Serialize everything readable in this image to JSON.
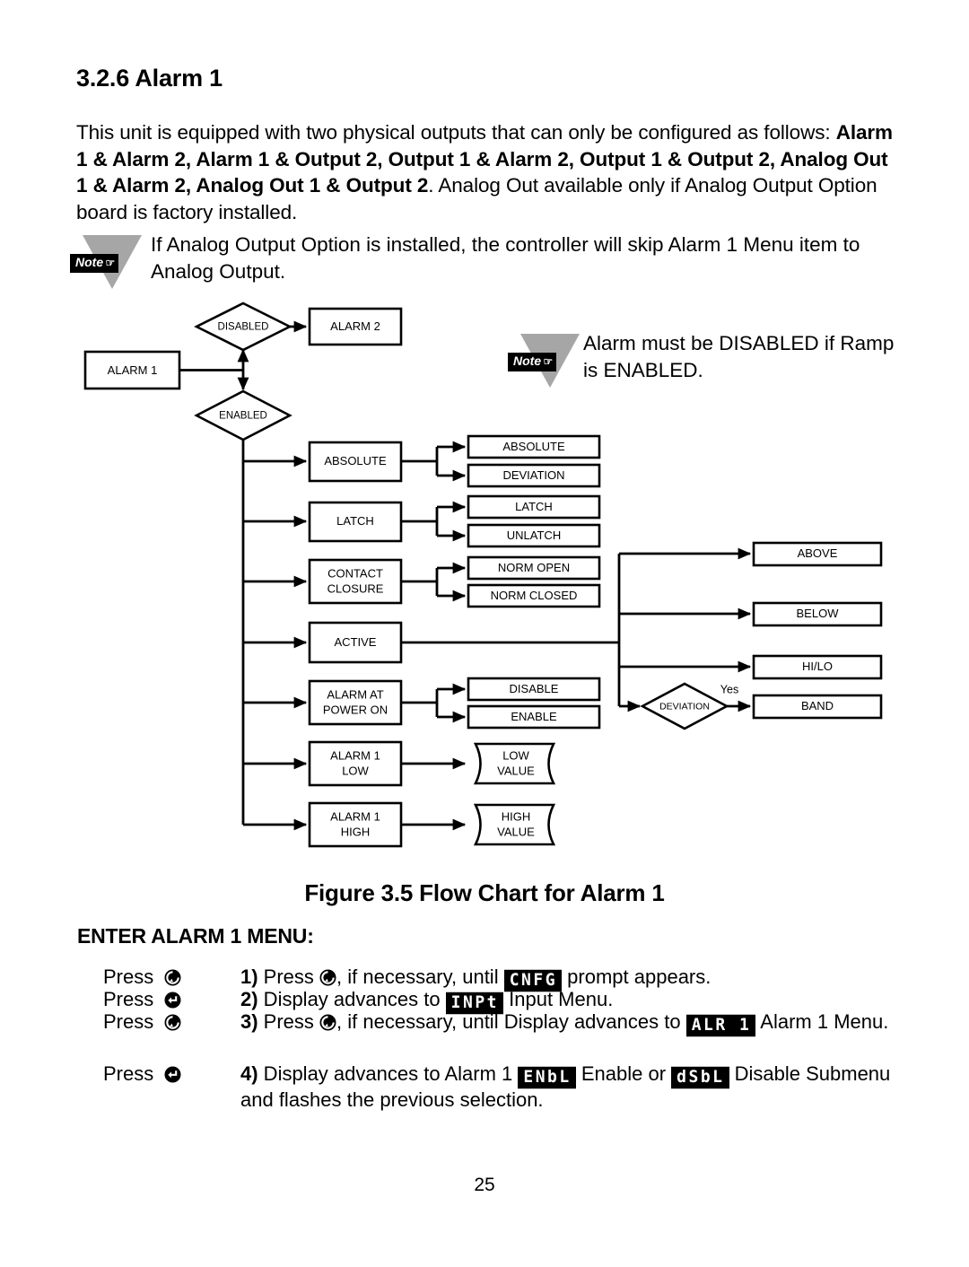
{
  "document": {
    "page_number": "25",
    "section_heading": "3.2.6 Alarm 1",
    "intro_paragraph": {
      "part1": "This unit is equipped with two physical outputs that can only be configured as follows: ",
      "bold": "Alarm 1 & Alarm 2, Alarm 1 & Output 2, Output 1 & Alarm 2, Output 1 & Output 2, Analog Out 1 & Alarm 2, Analog Out 1 & Output 2",
      "part2": ". Analog Out available only if Analog Output Option board is factory installed."
    },
    "note_label": "Note",
    "note1_text": "If Analog Output Option is installed, the controller will skip Alarm 1 Menu item to Analog Output.",
    "note2_text": "Alarm must be DISABLED if Ramp is ENABLED.",
    "figure_caption": "Figure 3.5 Flow Chart for Alarm 1",
    "menu_heading": "ENTER ALARM 1 MENU:"
  },
  "flowchart": {
    "nodes": {
      "alarm1": "ALARM 1",
      "disabled": "DISABLED",
      "enabled": "ENABLED",
      "alarm2": "ALARM 2",
      "absolute": "ABSOLUTE",
      "absolute_opt1": "ABSOLUTE",
      "absolute_opt2": "DEVIATION",
      "latch": "LATCH",
      "latch_opt1": "LATCH",
      "latch_opt2": "UNLATCH",
      "contact_closure_l1": "CONTACT",
      "contact_closure_l2": "CLOSURE",
      "contact_opt1": "NORM OPEN",
      "contact_opt2": "NORM CLOSED",
      "active": "ACTIVE",
      "alarm_at_power_on_l1": "ALARM AT",
      "alarm_at_power_on_l2": "POWER ON",
      "power_opt1": "DISABLE",
      "power_opt2": "ENABLE",
      "alarm1_low_l1": "ALARM 1",
      "alarm1_low_l2": "LOW",
      "low_value_l1": "LOW",
      "low_value_l2": "VALUE",
      "alarm1_high_l1": "ALARM 1",
      "alarm1_high_l2": "HIGH",
      "high_value_l1": "HIGH",
      "high_value_l2": "VALUE",
      "above": "ABOVE",
      "below": "BELOW",
      "hilo": "HI/LO",
      "deviation": "DEVIATION",
      "band": "BAND",
      "yes_label": "Yes"
    }
  },
  "steps": {
    "press_labels": [
      {
        "text": "Press",
        "icon": "menu-button-icon"
      },
      {
        "text": "Press",
        "icon": "enter-button-icon"
      },
      {
        "text": "Press",
        "icon": "menu-button-icon"
      },
      {
        "text": "Press",
        "icon": "enter-button-icon"
      }
    ],
    "items": [
      {
        "number": "1)",
        "before": " Press ",
        "after_icon": ", if necessary, until ",
        "lcd": "CNFG",
        "tail": " prompt appears."
      },
      {
        "number": "2)",
        "before": " Display advances to ",
        "after_icon": "",
        "lcd": "INPt",
        "tail": " Input Menu."
      },
      {
        "number": "3)",
        "before": " Press ",
        "after_icon": ", if necessary, until Display advances to ",
        "lcd": "ALR 1",
        "tail": " Alarm 1 Menu."
      },
      {
        "number": "4)",
        "before": " Display advances to Alarm 1 ",
        "after_icon": "",
        "lcd": "ENbL",
        "mid": " Enable or ",
        "lcd2": "dSbL",
        "tail": " Disable Submenu and flashes the previous selection."
      }
    ]
  },
  "colors": {
    "ink": "#000000",
    "paper": "#ffffff",
    "note_triangle": "#a6a6a6"
  }
}
